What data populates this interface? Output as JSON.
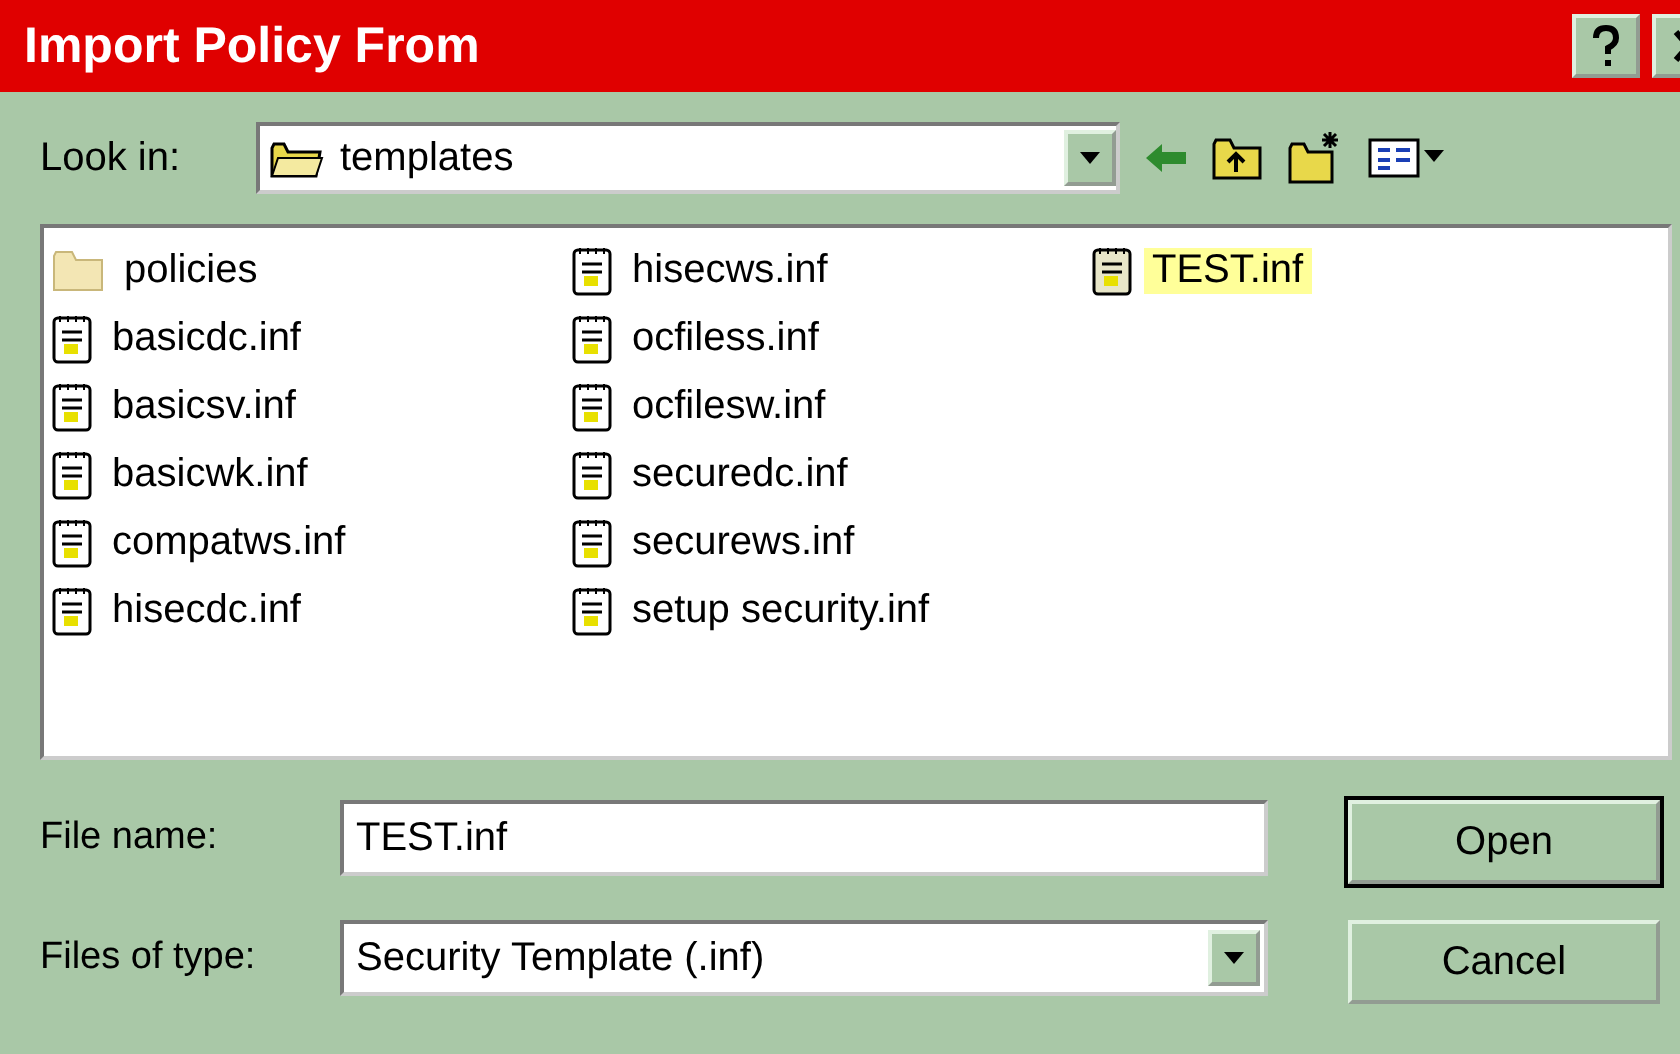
{
  "window": {
    "title": "Import Policy From"
  },
  "look_in": {
    "label": "Look in:",
    "value": "templates"
  },
  "files": [
    {
      "name": "policies",
      "kind": "folder",
      "selected": false
    },
    {
      "name": "basicdc.inf",
      "kind": "file",
      "selected": false
    },
    {
      "name": "basicsv.inf",
      "kind": "file",
      "selected": false
    },
    {
      "name": "basicwk.inf",
      "kind": "file",
      "selected": false
    },
    {
      "name": "compatws.inf",
      "kind": "file",
      "selected": false
    },
    {
      "name": "hisecdc.inf",
      "kind": "file",
      "selected": false
    },
    {
      "name": "hisecws.inf",
      "kind": "file",
      "selected": false
    },
    {
      "name": "ocfiless.inf",
      "kind": "file",
      "selected": false
    },
    {
      "name": "ocfilesw.inf",
      "kind": "file",
      "selected": false
    },
    {
      "name": "securedc.inf",
      "kind": "file",
      "selected": false
    },
    {
      "name": "securews.inf",
      "kind": "file",
      "selected": false
    },
    {
      "name": "setup security.inf",
      "kind": "file",
      "selected": false
    },
    {
      "name": "TEST.inf",
      "kind": "file",
      "selected": true
    }
  ],
  "file_name": {
    "label": "File name:",
    "value": "TEST.inf"
  },
  "file_type": {
    "label": "Files of type:",
    "value": "Security Template (.inf)"
  },
  "buttons": [
    "Open",
    "Cancel"
  ]
}
